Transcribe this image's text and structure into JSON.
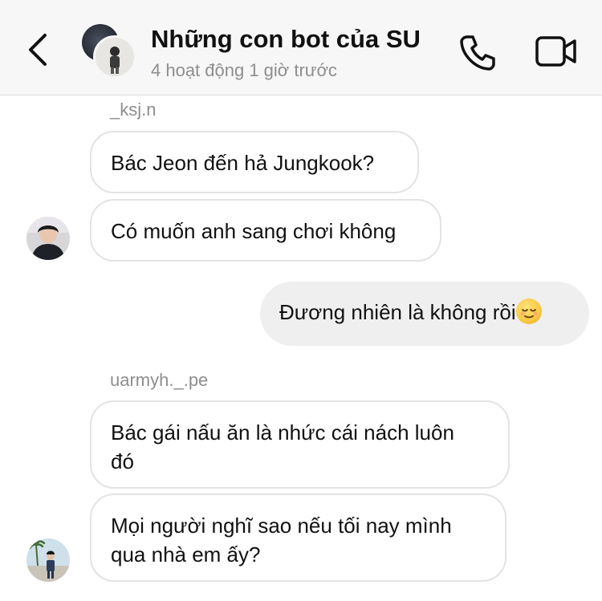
{
  "header": {
    "title": "Những con bot của SU",
    "subtitle": "4 hoạt động 1 giờ trước",
    "back_icon": "chevron-left-icon",
    "call_icon": "phone-icon",
    "video_icon": "video-camera-icon"
  },
  "messages": [
    {
      "sender": "_ksj.n",
      "text": "Bác Jeon đến hả Jungkook?"
    },
    {
      "text": "Có muốn anh sang chơi không"
    },
    {
      "text": "Đương nhiên là không rồi",
      "emoji": "relieved-face-emoji"
    },
    {
      "sender": "uarmyh._.pe",
      "line1": "Bác gái nấu ăn là nhức cái nách luôn",
      "line2": "đó"
    },
    {
      "line1": "Mọi người nghĩ sao nếu tối nay mình",
      "line2": "qua nhà em ấy?"
    }
  ],
  "colors": {
    "header_bg": "#f7f7f7",
    "incoming_border": "#e3e3e3",
    "outgoing_bg": "#efefef",
    "secondary_text": "#8e8e8e"
  }
}
